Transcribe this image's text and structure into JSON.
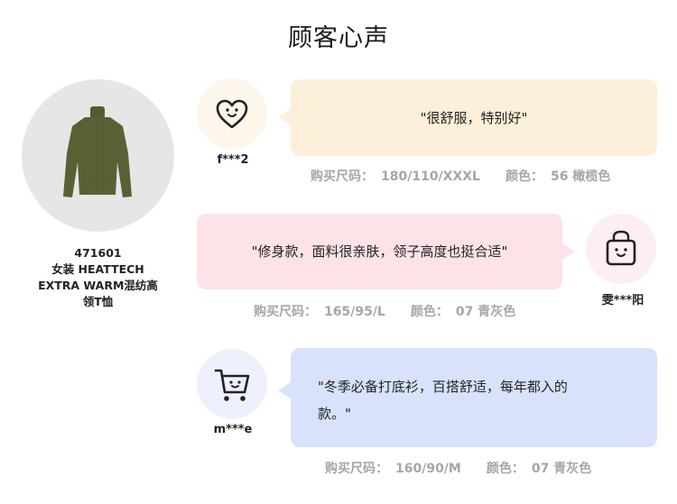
{
  "title": "顾客心声",
  "product": {
    "code": "471601",
    "name_line1": "女装 HEATTECH",
    "name_line2": "EXTRA WARM混纺高",
    "name_line3": "领T恤"
  },
  "size_label": "购买尺码：",
  "color_label": "颜色：",
  "reviews": [
    {
      "user": "f***2",
      "icon": "heart-smile-icon",
      "text": "\"很舒服，特别好\"",
      "size": "180/110/XXXL",
      "color": "56 橄榄色"
    },
    {
      "user": "雯***阳",
      "icon": "shopping-bag-smile-icon",
      "text": "\"修身款，面料很亲肤，领子高度也挺合适\"",
      "size": "165/95/L",
      "color": "07 青灰色"
    },
    {
      "user": "m***e",
      "icon": "shopping-cart-smile-icon",
      "text_line1": "\"冬季必备打底衫，百搭舒适，每年都入的",
      "text_line2": "款。\"",
      "size": "160/90/M",
      "color": "07 青灰色"
    }
  ],
  "colors": {
    "bubble1": "#fdf0da",
    "bubble2": "#fde3e7",
    "bubble3": "#d9e2fb",
    "avatar1": "#fdf6ea",
    "avatar2": "#fdeef1",
    "avatar3": "#eef0fd",
    "product_bg": "#e6e6e6",
    "garment": "#5a6033"
  }
}
